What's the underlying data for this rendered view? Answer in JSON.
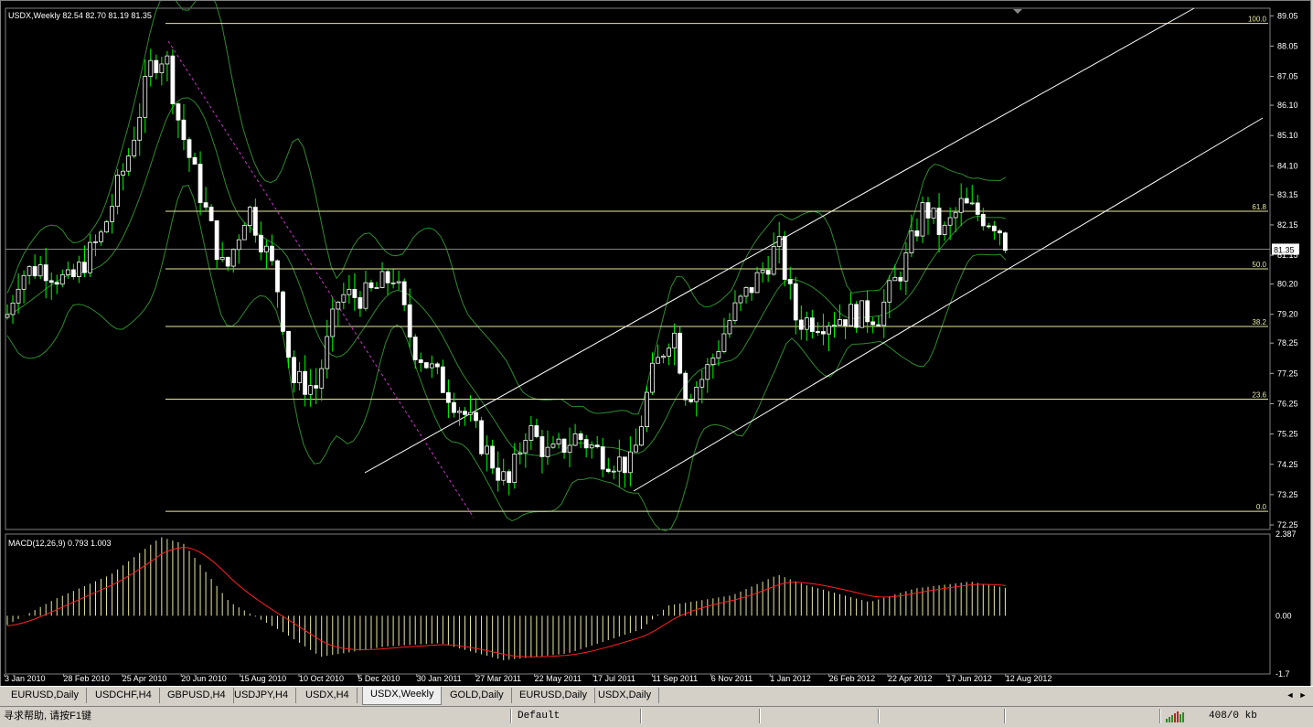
{
  "chart": {
    "header": "USDX,Weekly  82.54 82.70 81.19 81.35",
    "price_axis": [
      "89.05",
      "88.05",
      "87.05",
      "86.10",
      "85.10",
      "84.10",
      "83.15",
      "82.15",
      "81.15",
      "80.20",
      "79.20",
      "78.25",
      "77.25",
      "76.25",
      "75.25",
      "74.25",
      "73.25",
      "72.25"
    ],
    "current_price": "81.35",
    "fib_levels": [
      {
        "label": "100.0",
        "price": 88.8
      },
      {
        "label": "61.8",
        "price": 82.6
      },
      {
        "label": "50.0",
        "price": 80.7
      },
      {
        "label": "38.2",
        "price": 78.8
      },
      {
        "label": "23.6",
        "price": 76.4
      },
      {
        "label": "0.0",
        "price": 72.7
      }
    ],
    "macd_header": "MACD(12,26,9) 0.793 1.003",
    "macd_axis": [
      "2.387",
      "0.00",
      "-1.7"
    ],
    "dates": [
      "3 Jan 2010",
      "28 Feb 2010",
      "25 Apr 2010",
      "20 Jun 2010",
      "15 Aug 2010",
      "10 Oct 2010",
      "5 Dec 2010",
      "30 Jan 2011",
      "27 Mar 2011",
      "22 May 2011",
      "17 Jul 2011",
      "11 Sep 2011",
      "6 Nov 2011",
      "1 Jan 2012",
      "26 Feb 2012",
      "22 Apr 2012",
      "17 Jun 2012",
      "12 Aug 2012"
    ],
    "colors": {
      "background": "#000000",
      "candle": "#ffffff",
      "wick": "#00ff00",
      "bands": "#2e8b2e",
      "fib": "#e8e8a0",
      "channel": "#ffffff",
      "macd_hist": "#e8e8a0",
      "macd_signal": "#ff2020",
      "trendline": "#cc33cc"
    }
  },
  "tabs": [
    {
      "label": "EURUSD,Daily",
      "active": false
    },
    {
      "label": "USDCHF,H4",
      "active": false
    },
    {
      "label": "GBPUSD,H4",
      "active": false
    },
    {
      "label": "USDJPY,H4",
      "active": false
    },
    {
      "label": "USDX,H4",
      "active": false
    },
    {
      "label": "USDX,Weekly",
      "active": true
    },
    {
      "label": "GOLD,Daily",
      "active": false
    },
    {
      "label": "EURUSD,Daily",
      "active": false
    },
    {
      "label": "USDX,Daily",
      "active": false
    }
  ],
  "tab_scroll": {
    "left_icon": "arrow-left-icon",
    "right_icon": "arrow-right-icon",
    "left": "◄",
    "right": "►"
  },
  "status": {
    "help": "寻求帮助, 请按F1键",
    "profile": "Default",
    "traffic": "408/0 kb",
    "connection_icon": "connection-bars-icon"
  }
}
